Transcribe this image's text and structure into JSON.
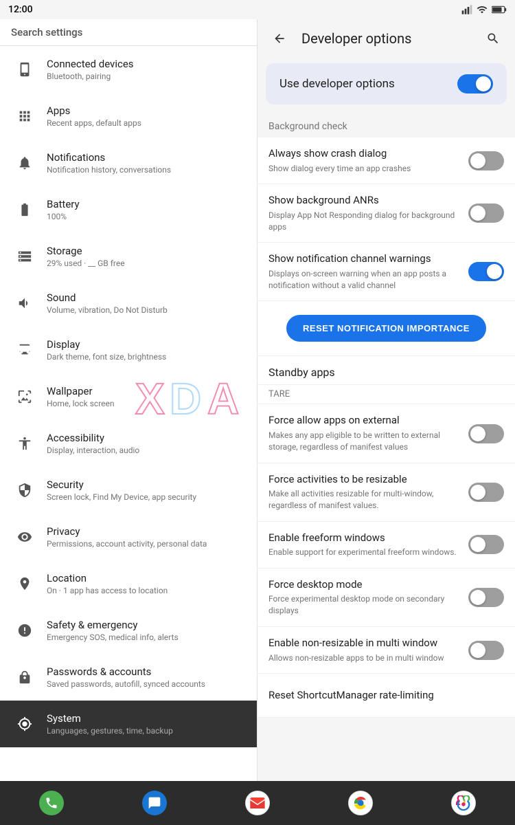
{
  "statusBar": {
    "time": "12:00",
    "batteryIcon": "🔋"
  },
  "sidebar": {
    "searchLabel": "Search settings",
    "items": [
      {
        "id": "connected-devices",
        "icon": "connected",
        "title": "Connected devices",
        "subtitle": "Bluetooth, pairing"
      },
      {
        "id": "apps",
        "icon": "apps",
        "title": "Apps",
        "subtitle": "Recent apps, default apps"
      },
      {
        "id": "notifications",
        "icon": "notifications",
        "title": "Notifications",
        "subtitle": "Notification history, conversations"
      },
      {
        "id": "battery",
        "icon": "battery",
        "title": "Battery",
        "subtitle": "100%"
      },
      {
        "id": "storage",
        "icon": "storage",
        "title": "Storage",
        "subtitle": "29% used · __ GB free"
      },
      {
        "id": "sound",
        "icon": "sound",
        "title": "Sound",
        "subtitle": "Volume, vibration, Do Not Disturb"
      },
      {
        "id": "display",
        "icon": "display",
        "title": "Display",
        "subtitle": "Dark theme, font size, brightness"
      },
      {
        "id": "wallpaper",
        "icon": "wallpaper",
        "title": "Wallpaper",
        "subtitle": "Home, lock screen"
      },
      {
        "id": "accessibility",
        "icon": "accessibility",
        "title": "Accessibility",
        "subtitle": "Display, interaction, audio"
      },
      {
        "id": "security",
        "icon": "security",
        "title": "Security",
        "subtitle": "Screen lock, Find My Device, app security"
      },
      {
        "id": "privacy",
        "icon": "privacy",
        "title": "Privacy",
        "subtitle": "Permissions, account activity, personal data"
      },
      {
        "id": "location",
        "icon": "location",
        "title": "Location",
        "subtitle": "On · 1 app has access to location"
      },
      {
        "id": "safety",
        "icon": "safety",
        "title": "Safety & emergency",
        "subtitle": "Emergency SOS, medical info, alerts"
      },
      {
        "id": "passwords",
        "icon": "passwords",
        "title": "Passwords & accounts",
        "subtitle": "Saved passwords, autofill, synced accounts"
      },
      {
        "id": "system",
        "icon": "system",
        "title": "System",
        "subtitle": "Languages, gestures, time, backup",
        "active": true
      }
    ]
  },
  "devOptions": {
    "headerTitle": "Developer options",
    "useDeveloperLabel": "Use developer options",
    "useDeveloperEnabled": true,
    "sectionBackgroundCheck": "Background check",
    "settings": [
      {
        "id": "crash-dialog",
        "title": "Always show crash dialog",
        "desc": "Show dialog every time an app crashes",
        "enabled": false
      },
      {
        "id": "background-anrs",
        "title": "Show background ANRs",
        "desc": "Display App Not Responding dialog for background apps",
        "enabled": false
      },
      {
        "id": "notification-channel-warnings",
        "title": "Show notification channel warnings",
        "desc": "Displays on-screen warning when an app posts a notification without a valid channel",
        "enabled": true
      }
    ],
    "resetButtonLabel": "RESET NOTIFICATION IMPORTANCE",
    "standbyAppsLabel": "Standby apps",
    "tareLabel": "TARE",
    "tareSettings": [
      {
        "id": "force-external",
        "title": "Force allow apps on external",
        "desc": "Makes any app eligible to be written to external storage, regardless of manifest values",
        "enabled": false
      },
      {
        "id": "resizable-activities",
        "title": "Force activities to be resizable",
        "desc": "Make all activities resizable for multi-window, regardless of manifest values.",
        "enabled": false
      },
      {
        "id": "freeform-windows",
        "title": "Enable freeform windows",
        "desc": "Enable support for experimental freeform windows.",
        "enabled": false
      },
      {
        "id": "desktop-mode",
        "title": "Force desktop mode",
        "desc": "Force experimental desktop mode on secondary displays",
        "enabled": false
      },
      {
        "id": "non-resizable-multi",
        "title": "Enable non-resizable in multi window",
        "desc": "Allows non-resizable apps to be in multi window",
        "enabled": false
      },
      {
        "id": "shortcut-rate-limit",
        "title": "Reset ShortcutManager rate-limiting",
        "desc": "",
        "enabled": null
      }
    ]
  },
  "bottomNav": {
    "items": [
      {
        "id": "phone",
        "color": "#4caf50"
      },
      {
        "id": "messages",
        "color": "#1976d2"
      },
      {
        "id": "gmail",
        "color": "#e53935"
      },
      {
        "id": "chrome",
        "color": "#1976d2"
      },
      {
        "id": "photos",
        "color": "#e91e63"
      }
    ]
  }
}
